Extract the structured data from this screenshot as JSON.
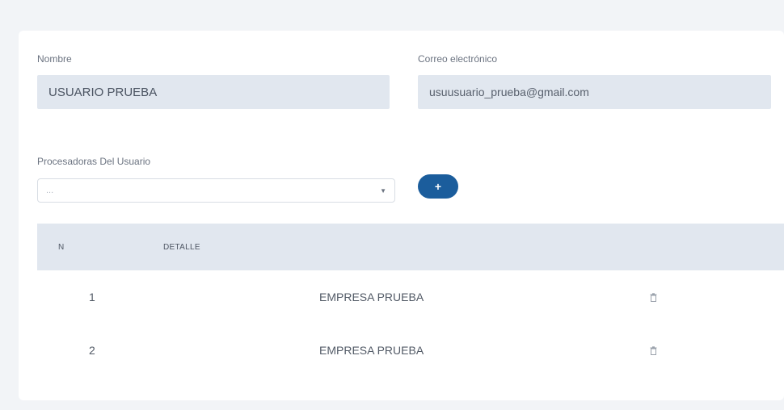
{
  "form": {
    "name_label": "Nombre",
    "name_value": "USUARIO PRUEBA",
    "email_label": "Correo electrónico",
    "email_value": "usuusuario_prueba@gmail.com",
    "processors_label": "Procesadoras Del Usuario",
    "processors_select_value": "...",
    "add_button_label": "+"
  },
  "table": {
    "headers": [
      "N",
      "DETALLE"
    ],
    "rows": [
      {
        "n": "1",
        "detalle": "EMPRESA PRUEBA",
        "action_icon": "trash-icon"
      },
      {
        "n": "2",
        "detalle": "EMPRESA PRUEBA",
        "action_icon": "trash-icon"
      }
    ]
  },
  "colors": {
    "accent": "#1b5d9c",
    "input_fill": "#e1e7ef",
    "background": "#f2f4f7"
  }
}
